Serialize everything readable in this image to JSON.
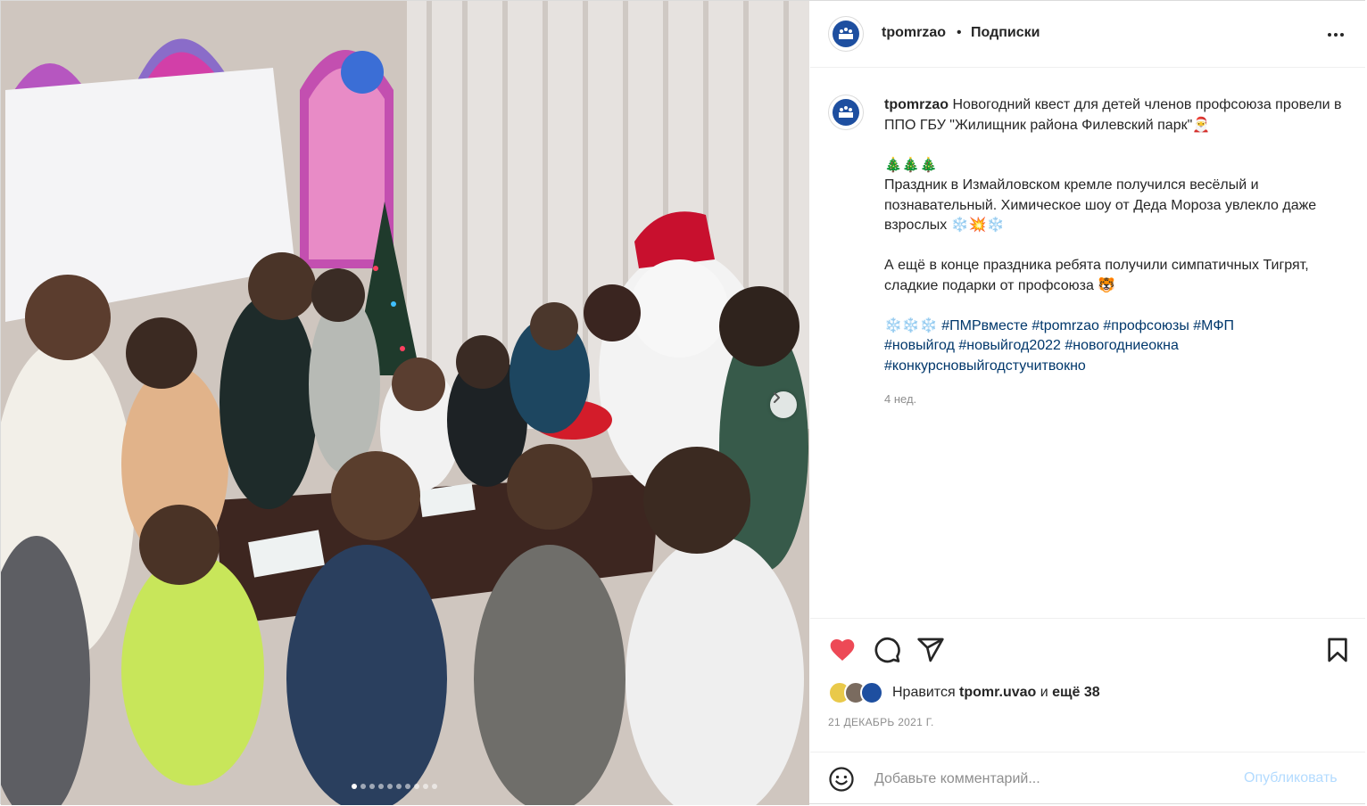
{
  "post": {
    "username": "tpomrzao",
    "bullet": "•",
    "follow_label": "Подписки",
    "more_icon": "more-horizontal-icon"
  },
  "caption": {
    "username": "tpomrzao",
    "line1": " Новогодний квест для детей членов профсоюза провели в ППО ГБУ \"Жилищник района Филевский парк\"🎅",
    "trees": "🎄🎄🎄",
    "para2": "Праздник в Измайловском кремле получился весёлый и познавательный. Химическое шоу от Деда Мороза увлекло даже взрослых ❄️💥❄️",
    "para3": "А ещё в конце праздника ребята получили симпатичных Тигрят, сладкие подарки от профсоюза 🐯",
    "tags_prefix": "❄️❄️❄️",
    "tags": [
      "#ПМРвместе",
      "#tpomrzao",
      "#профсоюзы",
      "#МФП",
      "#новыйгод",
      "#новыйгод2022",
      "#новогодниеокна",
      "#конкурсновыйгодстучитвокно"
    ],
    "time": "4 нед."
  },
  "actions": {
    "like_icon": "heart-filled-icon",
    "comment_icon": "comment-icon",
    "share_icon": "share-icon",
    "save_icon": "bookmark-icon",
    "like_color": "#ed4956"
  },
  "likes": {
    "prefix": "Нравится ",
    "user": "tpomr.uvao",
    "middle": " и ",
    "others": "ещё 38"
  },
  "date": "21 ДЕКАБРЬ 2021 Г.",
  "comment": {
    "placeholder": "Добавьте комментарий...",
    "publish_label": "Опубликовать"
  },
  "carousel": {
    "slides": 10,
    "active": 1
  },
  "colors": {
    "link": "#00376b",
    "muted": "#8e8e8e",
    "publish_disabled": "#b3dbff"
  }
}
